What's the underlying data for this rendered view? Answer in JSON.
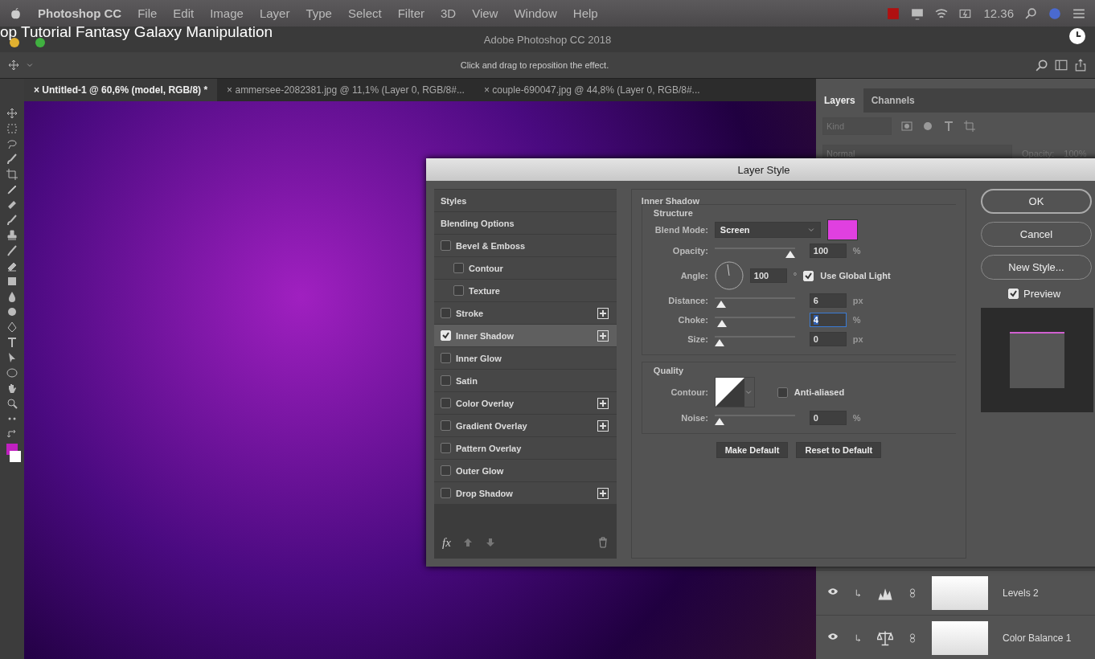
{
  "menubar": {
    "app": "Photoshop CC",
    "items": [
      "File",
      "Edit",
      "Image",
      "Layer",
      "Type",
      "Select",
      "Filter",
      "3D",
      "View",
      "Window",
      "Help"
    ],
    "time": "12.36"
  },
  "video_title": "op Tutorial Fantasy Galaxy Manipulation",
  "window_title": "Adobe Photoshop CC 2018",
  "options_hint": "Click and drag to reposition the effect.",
  "doc_tabs": [
    {
      "close": "×",
      "label": "Untitled-1 @ 60,6% (model, RGB/8) *",
      "selected": true
    },
    {
      "close": "×",
      "label": "ammersee-2082381.jpg @ 11,1% (Layer 0, RGB/8#...",
      "selected": false
    },
    {
      "close": "×",
      "label": "couple-690047.jpg @ 44,8% (Layer 0, RGB/8#...",
      "selected": false
    }
  ],
  "layers_panel": {
    "tabs": [
      {
        "label": "Layers",
        "selected": true
      },
      {
        "label": "Channels",
        "selected": false
      }
    ],
    "filter_placeholder": "Kind",
    "blend_mode": "Normal",
    "opacity_label": "Opacity:",
    "opacity_value": "100%",
    "layers": [
      {
        "name": "Levels 2",
        "visible": true,
        "kind": "levels"
      },
      {
        "name": "Color Balance 1",
        "visible": true,
        "kind": "balance"
      }
    ]
  },
  "dialog": {
    "title": "Layer Style",
    "styles": [
      {
        "label": "Styles",
        "kind": "header",
        "selected": false
      },
      {
        "label": "Blending Options",
        "kind": "header",
        "selected": false
      },
      {
        "label": "Bevel & Emboss",
        "kind": "effect",
        "checked": false,
        "selected": false,
        "add": false,
        "children": [
          {
            "label": "Contour",
            "kind": "effect",
            "checked": false,
            "selected": false,
            "add": false
          },
          {
            "label": "Texture",
            "kind": "effect",
            "checked": false,
            "selected": false,
            "add": false
          }
        ]
      },
      {
        "label": "Stroke",
        "kind": "effect",
        "checked": false,
        "selected": false,
        "add": true
      },
      {
        "label": "Inner Shadow",
        "kind": "effect",
        "checked": true,
        "selected": true,
        "add": true
      },
      {
        "label": "Inner Glow",
        "kind": "effect",
        "checked": false,
        "selected": false,
        "add": false
      },
      {
        "label": "Satin",
        "kind": "effect",
        "checked": false,
        "selected": false,
        "add": false
      },
      {
        "label": "Color Overlay",
        "kind": "effect",
        "checked": false,
        "selected": false,
        "add": true
      },
      {
        "label": "Gradient Overlay",
        "kind": "effect",
        "checked": false,
        "selected": false,
        "add": true
      },
      {
        "label": "Pattern Overlay",
        "kind": "effect",
        "checked": false,
        "selected": false,
        "add": false
      },
      {
        "label": "Outer Glow",
        "kind": "effect",
        "checked": false,
        "selected": false,
        "add": false
      },
      {
        "label": "Drop Shadow",
        "kind": "effect",
        "checked": false,
        "selected": false,
        "add": true
      }
    ],
    "fx_label": "fx",
    "section_title": "Inner Shadow",
    "structure_title": "Structure",
    "blend_label": "Blend Mode:",
    "blend_value": "Screen",
    "color": "#e040e0",
    "opacity": {
      "label": "Opacity:",
      "level": 1.0,
      "value": "100",
      "unit": "%"
    },
    "angle": {
      "label": "Angle:",
      "value": "100",
      "unit": "°",
      "global_label": "Use Global Light",
      "global_checked": true
    },
    "structure_sliders": [
      {
        "label": "Distance:",
        "level": 0.02,
        "value": "6",
        "unit": "px",
        "focused": false
      },
      {
        "label": "Choke:",
        "level": 0.04,
        "value": "4",
        "unit": "%",
        "focused": true
      },
      {
        "label": "Size:",
        "level": 0.0,
        "value": "0",
        "unit": "px",
        "focused": false
      }
    ],
    "quality_title": "Quality",
    "contour_label": "Contour:",
    "anti_alias": {
      "label": "Anti-aliased",
      "checked": false
    },
    "noise": {
      "label": "Noise:",
      "level": 0.0,
      "value": "0",
      "unit": "%",
      "focused": false
    },
    "buttons": [
      "Make Default",
      "Reset to Default"
    ],
    "side_buttons": [
      {
        "label": "OK",
        "default": true
      },
      {
        "label": "Cancel",
        "default": false
      },
      {
        "label": "New Style...",
        "default": false
      }
    ],
    "preview": {
      "label": "Preview",
      "checked": true
    }
  }
}
